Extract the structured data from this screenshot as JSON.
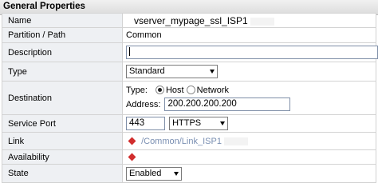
{
  "section_title": "General Properties",
  "name": {
    "label": "Name",
    "value": "vserver_mypage_ssl_ISP1"
  },
  "partition": {
    "label": "Partition / Path",
    "value": "Common"
  },
  "description": {
    "label": "Description",
    "value": ""
  },
  "type": {
    "label": "Type",
    "selected": "Standard"
  },
  "destination": {
    "label": "Destination",
    "type_label": "Type:",
    "options": [
      "Host",
      "Network"
    ],
    "selected": "Host",
    "address_label": "Address:",
    "address": "200.200.200.200"
  },
  "service_port": {
    "label": "Service Port",
    "port": "443",
    "protocol": "HTTPS"
  },
  "link": {
    "label": "Link",
    "value": "/Common/Link_ISP1"
  },
  "availability": {
    "label": "Availability"
  },
  "state": {
    "label": "State",
    "selected": "Enabled"
  },
  "colors": {
    "status_red": "#d12d2d",
    "label_bg": "#eef0f3",
    "link_text": "#7a8fb2"
  }
}
